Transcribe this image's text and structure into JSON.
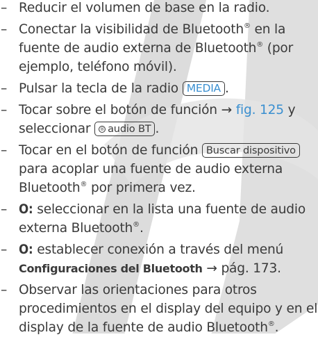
{
  "colors": {
    "text": "#3a3a3a",
    "accent": "#3a8fd0",
    "watermark": "#d9d9d9"
  },
  "steps": [
    {
      "text": "Reducir el volumen de base en la radio."
    },
    {
      "a": "Conectar la visibilidad de Bluetooth",
      "sup": "®",
      "b": " en la fuente de audio externa de Bluetooth",
      "c": " (por ejemplo, teléfono móvil)."
    },
    {
      "a": "Pulsar la tecla de la radio ",
      "key": "MEDIA",
      "b": "."
    },
    {
      "a": "Tocar sobre el botón de función ",
      "arrow": "→ ",
      "link": "fig. 125",
      "b": " y seleccionar ",
      "key_icon": "®",
      "key": "audio BT",
      "c": "."
    },
    {
      "a": "Tocar en el botón de función ",
      "key": "Buscar dispositivo",
      "b": " para acoplar una fuente de audio externa Bluetooth",
      "c": " por primera vez."
    },
    {
      "bold": "O:",
      "a": " seleccionar en la lista una fuente de audio externa Bluetooth",
      "b": "."
    },
    {
      "bold": "O:",
      "a": " establecer conexión a través del menú ",
      "bold2": "Configuraciones del Bluetooth",
      "b": " → pág. 173."
    },
    {
      "a": "Observar las orientaciones para otros procedimientos en el display del equipo y en el display de la fuente de audio Bluetooth",
      "b": "."
    }
  ]
}
